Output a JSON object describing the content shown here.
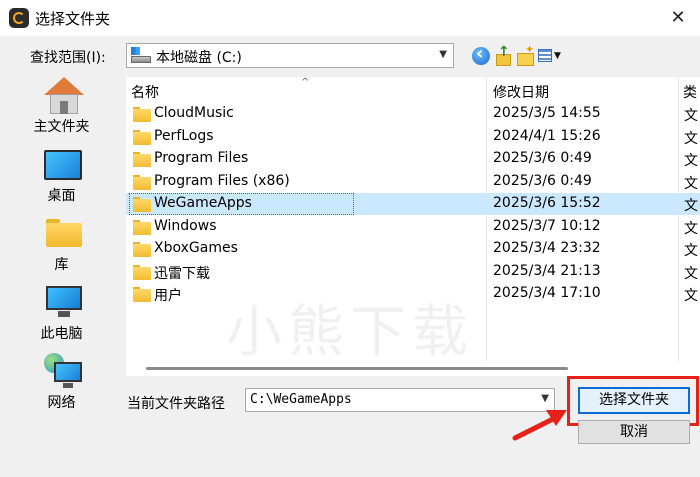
{
  "window": {
    "title": "选择文件夹",
    "close_icon": "close-icon"
  },
  "lookin": {
    "label": "查找范围(I):",
    "value": "本地磁盘 (C:)"
  },
  "toolbar": {
    "icons": [
      "back-icon",
      "up-folder-icon",
      "new-folder-icon",
      "view-menu-icon"
    ]
  },
  "places": [
    {
      "label": "主文件夹",
      "icon": "home-icon"
    },
    {
      "label": "桌面",
      "icon": "desktop-icon"
    },
    {
      "label": "库",
      "icon": "library-folder-icon"
    },
    {
      "label": "此电脑",
      "icon": "computer-icon"
    },
    {
      "label": "网络",
      "icon": "network-icon"
    }
  ],
  "columns": {
    "name": "名称",
    "date": "修改日期",
    "type": "类"
  },
  "files": [
    {
      "name": "CloudMusic",
      "date": "2025/3/5 14:55",
      "type": "文"
    },
    {
      "name": "PerfLogs",
      "date": "2024/4/1 15:26",
      "type": "文"
    },
    {
      "name": "Program Files",
      "date": "2025/3/6 0:49",
      "type": "文"
    },
    {
      "name": "Program Files (x86)",
      "date": "2025/3/6 0:49",
      "type": "文"
    },
    {
      "name": "WeGameApps",
      "date": "2025/3/6 15:52",
      "type": "文",
      "selected": true
    },
    {
      "name": "Windows",
      "date": "2025/3/7 10:12",
      "type": "文"
    },
    {
      "name": "XboxGames",
      "date": "2025/3/4 23:32",
      "type": "文"
    },
    {
      "name": "迅雷下载",
      "date": "2025/3/4 21:13",
      "type": "文"
    },
    {
      "name": "用户",
      "date": "2025/3/4 17:10",
      "type": "文"
    }
  ],
  "watermark": "小熊下载",
  "footer": {
    "path_label": "当前文件夹路径",
    "path_value": "C:\\WeGameApps",
    "select_button": "选择文件夹",
    "cancel_button": "取消"
  },
  "colors": {
    "selection": "#cce8ff",
    "highlight": "#e8201a",
    "accent": "#0a6cd6"
  }
}
